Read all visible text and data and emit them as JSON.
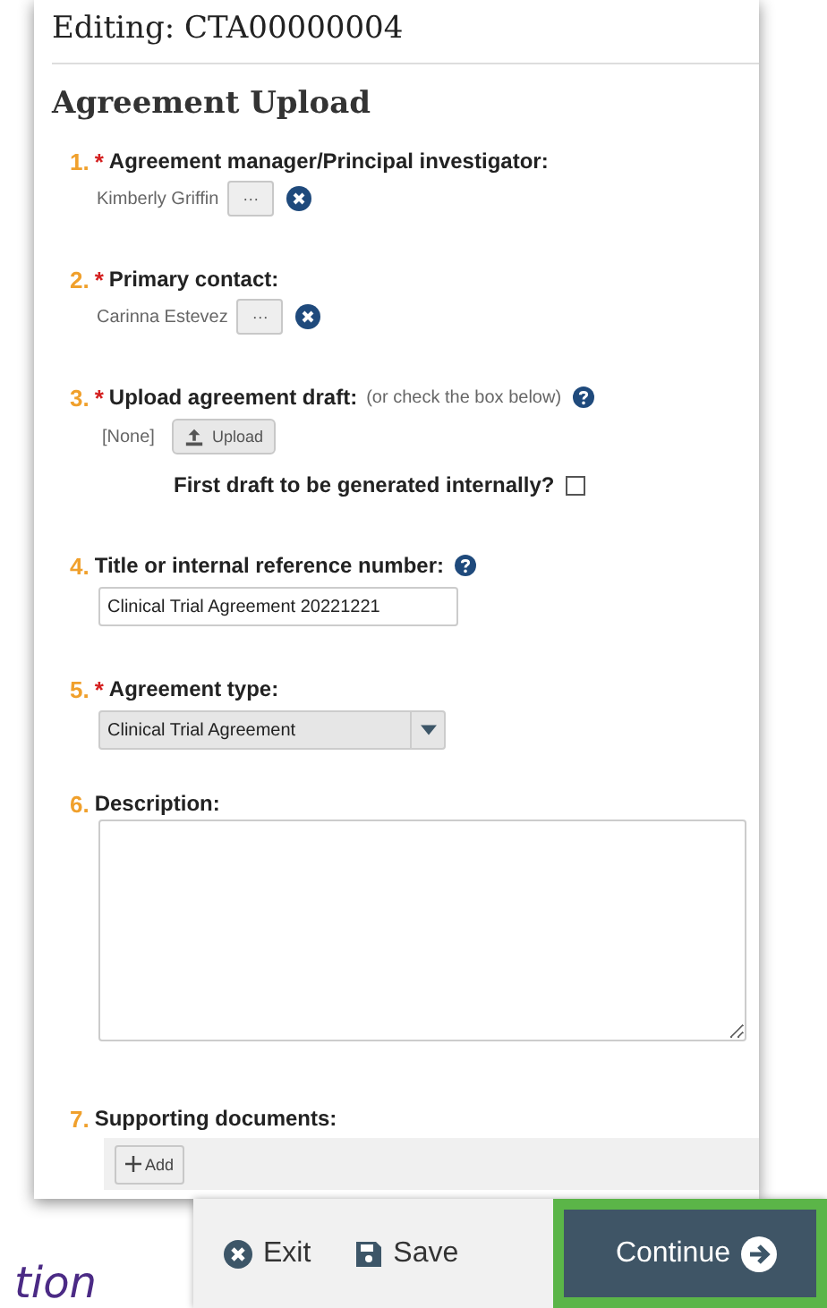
{
  "dialog_title": "Editing: CTA00000004",
  "section_title": "Agreement Upload",
  "fields": [
    {
      "kind": "person",
      "number": "1.",
      "required_mark": "*",
      "label": "Agreement manager/Principal investigator:",
      "value": "Kimberly Griffin",
      "browse_button": "···"
    },
    {
      "kind": "person",
      "number": "2.",
      "required_mark": "*",
      "label": "Primary contact:",
      "value": "Carinna Estevez",
      "browse_button": "···"
    },
    {
      "kind": "upload",
      "number": "3.",
      "required_mark": "*",
      "label": "Upload agreement draft:",
      "hint": "(or check the box below)",
      "help": true,
      "file": "[None]",
      "button": "Upload",
      "checkbox": {
        "label": "First draft to be generated internally?",
        "checked": false
      }
    },
    {
      "kind": "text",
      "number": "4.",
      "label": "Title or internal reference number:",
      "help": true,
      "value": "Clinical Trial Agreement 20221221"
    },
    {
      "kind": "select",
      "number": "5.",
      "required_mark": "*",
      "label": "Agreement type:",
      "value": "Clinical Trial Agreement"
    },
    {
      "kind": "textarea",
      "number": "6.",
      "label": "Description:"
    },
    {
      "kind": "documents",
      "number": "7.",
      "label": "Supporting documents:",
      "button": "Add"
    }
  ],
  "background_text": "tion",
  "footer_buttons": [
    {
      "kind": "exit",
      "label": "Exit",
      "highlighted": false
    },
    {
      "kind": "save",
      "label": "Save",
      "highlighted": false
    },
    {
      "kind": "continue",
      "label": "Continue",
      "highlighted": true
    }
  ]
}
